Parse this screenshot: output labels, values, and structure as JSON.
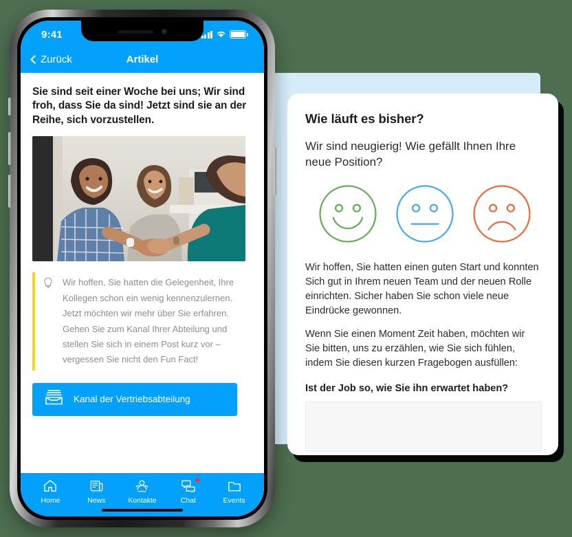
{
  "background_color": "#4d6e50",
  "accent_color": "#03a1fb",
  "phone": {
    "status_bar": {
      "time": "9:41",
      "signal_icon": "cellular-bars-icon",
      "wifi_icon": "wifi-icon",
      "battery_icon": "battery-full-icon"
    },
    "nav": {
      "back_label": "Zurück",
      "back_icon": "chevron-left-icon",
      "title": "Artikel"
    },
    "article": {
      "title": "Sie sind seit einer Woche bei uns; Wir sind froh, dass Sie da sind! Jetzt sind sie an der Reihe, sich vorzustellen.",
      "image_alt": "handshake-photo",
      "callout_icon": "lightbulb-icon",
      "callout_text": "Wir hoffen, Sie hatten die Gelegenheit, Ihre Kollegen schon ein wenig kennenzulernen. Jetzt möchten wir mehr über Sie erfahren. Gehen Sie zum Kanal Ihrer Abteilung und stellen Sie sich in einem Post kurz vor – vergessen Sie nicht den Fun Fact!",
      "callout_bar_color": "#f9d419",
      "cta_label": "Kanal der Vertriebsabteilung",
      "cta_icon": "inbox-tray-icon"
    },
    "tabbar": [
      {
        "label": "Home",
        "icon": "home-icon",
        "badge": false
      },
      {
        "label": "News",
        "icon": "newspaper-icon",
        "badge": false
      },
      {
        "label": "Kontakte",
        "icon": "contacts-icon",
        "badge": false
      },
      {
        "label": "Chat",
        "icon": "chat-bubbles-icon",
        "badge": true
      },
      {
        "label": "Events",
        "icon": "folder-icon",
        "badge": false
      }
    ]
  },
  "survey": {
    "title": "Wie läuft es bisher?",
    "subtitle": "Wir sind neugierig! Wie gefällt Ihnen Ihre neue Position?",
    "faces": [
      {
        "name": "happy-face-icon",
        "color": "#63ab54"
      },
      {
        "name": "neutral-face-icon",
        "color": "#42aaf0"
      },
      {
        "name": "sad-face-icon",
        "color": "#ef6637"
      }
    ],
    "paragraph_1": "Wir hoffen, Sie hatten einen guten Start und konnten Sich gut in Ihrem neuen Team und der neuen Rolle einrichten. Sicher haben Sie schon viele neue Eindrücke gewonnen.",
    "paragraph_2": "Wenn Sie einen Moment Zeit haben, möchten wir Sie bitten, uns zu erzählen, wie Sie sich fühlen, indem Sie diesen kurzen Fragebogen ausfüllen:",
    "question_label": "Ist der Job so, wie Sie ihn erwartet haben?",
    "answer_value": "",
    "answer_placeholder": ""
  }
}
